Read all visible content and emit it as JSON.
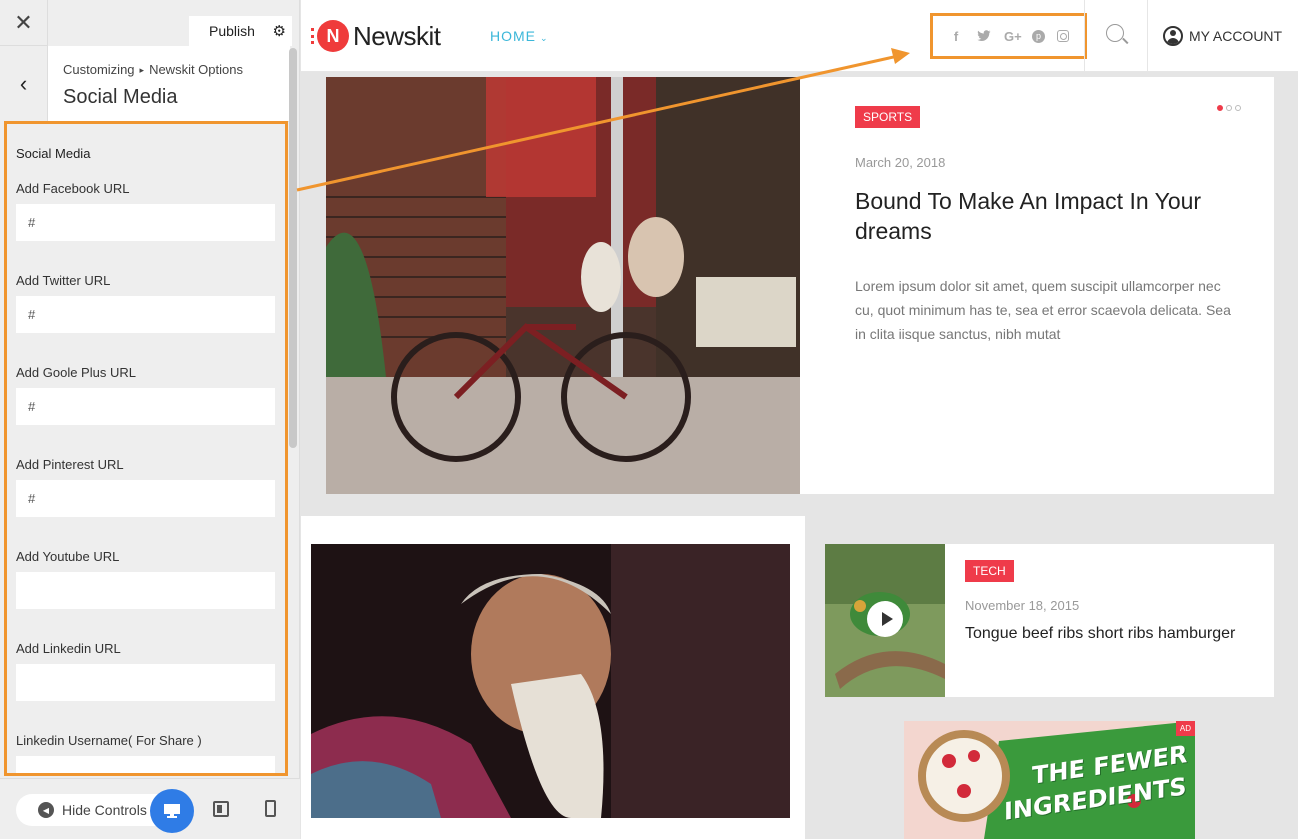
{
  "customizer": {
    "close_label": "✕",
    "publish_label": "Publish",
    "gear_glyph": "⚙",
    "back_glyph": "‹",
    "breadcrumb": [
      "Customizing",
      "Newskit Options"
    ],
    "breadcrumb_sep": "▸",
    "section_title": "Social Media",
    "fields_heading": "Social Media",
    "fields": [
      {
        "label": "Add Facebook URL",
        "value": "#"
      },
      {
        "label": "Add Twitter URL",
        "value": "#"
      },
      {
        "label": "Add Goole Plus URL",
        "value": "#"
      },
      {
        "label": "Add Pinterest URL",
        "value": "#"
      },
      {
        "label": "Add Youtube URL",
        "value": ""
      },
      {
        "label": "Add Linkedin URL",
        "value": ""
      },
      {
        "label": "Linkedin Username( For Share )",
        "value": ""
      }
    ],
    "hide_controls_label": "Hide Controls",
    "accent_color": "#2f7ce6",
    "highlight_color": "#f0952e"
  },
  "site": {
    "logo_text": "Newskit",
    "logo_letter": "N",
    "nav": {
      "home_label": "HOME",
      "chevron": "⌄"
    },
    "social_icons": [
      {
        "icon": "facebook-icon",
        "glyph": "f"
      },
      {
        "icon": "twitter-icon",
        "glyph": "🐦"
      },
      {
        "icon": "google-plus-icon",
        "glyph": "G+"
      },
      {
        "icon": "pinterest-icon",
        "glyph": "p"
      },
      {
        "icon": "instagram-icon",
        "glyph": ""
      }
    ],
    "account_label": "MY ACCOUNT",
    "brand_color": "#ef3b3b",
    "nav_color": "#3bb7d9"
  },
  "featured": {
    "category": "SPORTS",
    "date": "March 20, 2018",
    "title": "Bound To Make An Impact In Your dreams",
    "excerpt": "Lorem ipsum dolor sit amet, quem suscipit ullamcorper nec cu, quot minimum has te, sea et error scaevola delicata. Sea in clita iisque sanctus, nibh mutat",
    "slide_count": 3,
    "active_slide": 1
  },
  "side_post": {
    "category": "TECH",
    "date": "November 18, 2015",
    "title": "Tongue beef ribs short ribs hamburger"
  },
  "ad": {
    "badge": "AD",
    "line1": "THE FEWER",
    "line2": "INGREDIENTS"
  }
}
